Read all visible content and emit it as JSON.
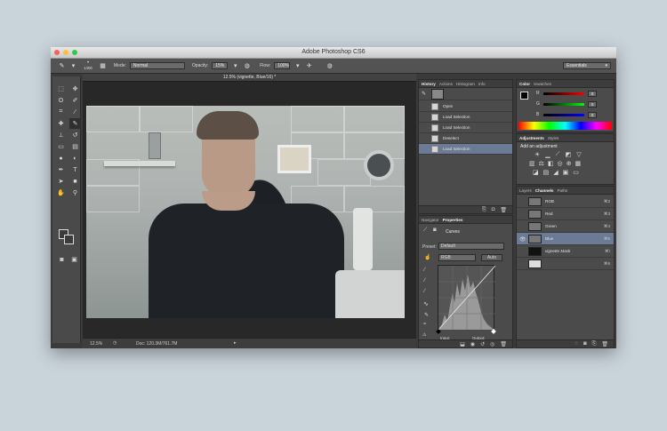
{
  "window": {
    "title": "Adobe Photoshop CS6",
    "traffic": {
      "close": "#fc605b",
      "min": "#fdbc40",
      "max": "#34c84a"
    }
  },
  "options_bar": {
    "brush_size": "1400",
    "mode_label": "Mode:",
    "mode_value": "Normal",
    "opacity_label": "Opacity:",
    "opacity_value": "15%",
    "flow_label": "Flow:",
    "flow_value": "100%",
    "workspace": "Essentials"
  },
  "document": {
    "tab_title": "12.5% (vignette, Blue/16) *",
    "zoom": "12.5%",
    "doc_info": "Doc: 120.3M/761.7M"
  },
  "history": {
    "tabs": [
      "History",
      "Actions",
      "Histogram",
      "Info"
    ],
    "active_tab": "History",
    "items": [
      "Open",
      "Load Selection",
      "Load Selection",
      "Deselect",
      "Load Selection"
    ],
    "selected_index": 4
  },
  "properties": {
    "tabs": [
      "Navigator",
      "Properties"
    ],
    "active_tab": "Properties",
    "adjustment_name": "Curves",
    "preset_label": "Preset:",
    "preset_value": "Default",
    "channel_value": "RGB",
    "auto_label": "Auto",
    "input_label": "Input:",
    "output_label": "Output:"
  },
  "color_panel": {
    "tabs": [
      "Color",
      "Swatches"
    ],
    "active_tab": "Color",
    "r_label": "R",
    "g_label": "G",
    "b_label": "B",
    "r_value": "0",
    "g_value": "0",
    "b_value": "0",
    "foreground": "#000000"
  },
  "adjustments_panel": {
    "tabs": [
      "Adjustments",
      "Styles"
    ],
    "active_tab": "Adjustments",
    "heading": "Add an adjustment"
  },
  "channels_panel": {
    "tabs": [
      "Layers",
      "Channels",
      "Paths"
    ],
    "active_tab": "Channels",
    "rows": [
      {
        "name": "RGB",
        "key": "⌘2"
      },
      {
        "name": "Red",
        "key": "⌘3"
      },
      {
        "name": "Green",
        "key": "⌘4"
      },
      {
        "name": "Blue",
        "key": "⌘5"
      },
      {
        "name": "vignette Mask",
        "key": "⌘\\"
      },
      {
        "name": "",
        "key": "⌘6"
      }
    ],
    "selected_index": 3
  },
  "colors": {
    "accent_selected": "#6b7b95",
    "panel_bg": "#4b4b4b",
    "desktop_bg": "#c9d3da"
  }
}
